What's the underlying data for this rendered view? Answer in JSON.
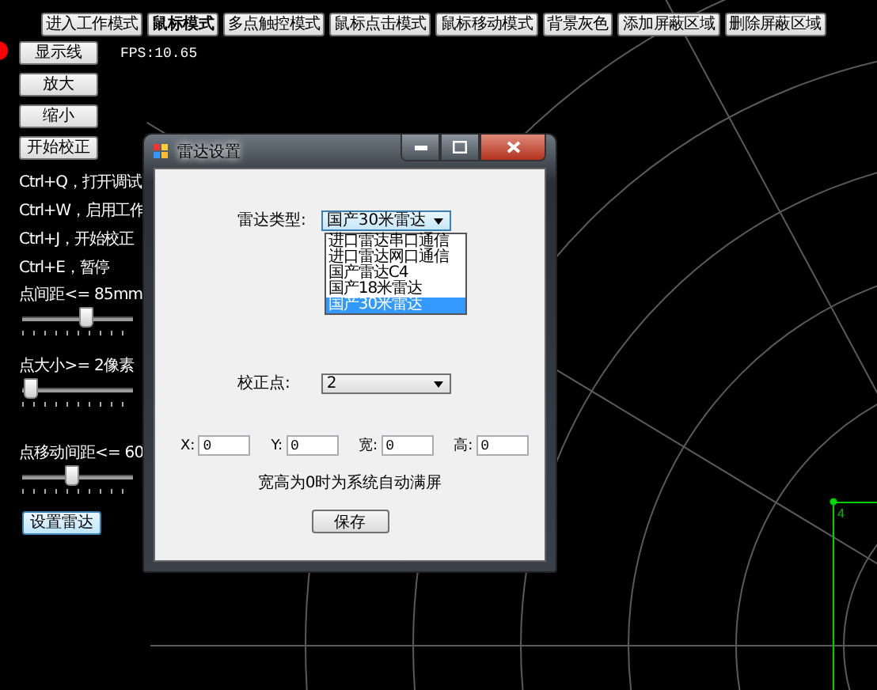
{
  "toolbar": [
    {
      "label": "进入工作模式",
      "selected": false
    },
    {
      "label": "鼠标模式",
      "selected": true
    },
    {
      "label": "多点触控模式",
      "selected": false
    },
    {
      "label": "鼠标点击模式",
      "selected": false
    },
    {
      "label": "鼠标移动模式",
      "selected": false
    },
    {
      "label": "背景灰色",
      "selected": false
    },
    {
      "label": "添加屏蔽区域",
      "selected": false
    },
    {
      "label": "删除屏蔽区域",
      "selected": false
    }
  ],
  "left_panel": {
    "buttons": [
      "显示线",
      "放大",
      "缩小",
      "开始校正"
    ],
    "fps": "FPS:10.65",
    "shortcuts": [
      "Ctrl+Q，打开调试",
      "Ctrl+W，启用工作",
      "Ctrl+J，开始校正",
      "Ctrl+E，暂停"
    ],
    "sliders": [
      {
        "label": "点间距<= 85mm",
        "level": 0.6
      },
      {
        "label": "点大小>= 2像素",
        "level": 0.05
      },
      {
        "label": "点移动间距<= 60",
        "level": 0.45
      }
    ],
    "radar_settings_button": "设置雷达"
  },
  "radar_view": {
    "marker_label": "4"
  },
  "dialog": {
    "title": "雷达设置",
    "radar_type_label": "雷达类型:",
    "radar_type_value": "国产30米雷达",
    "radar_type_options": [
      {
        "label": "进口雷达串口通信",
        "selected": false
      },
      {
        "label": "进口雷达网口通信",
        "selected": false
      },
      {
        "label": "国产雷达C4",
        "selected": false
      },
      {
        "label": "国产18米雷达",
        "selected": false
      },
      {
        "label": "国产30米雷达",
        "selected": true
      }
    ],
    "calibration_label": "校正点:",
    "calibration_value": "2",
    "fields": [
      {
        "label": "X:",
        "value": "0"
      },
      {
        "label": "Y:",
        "value": "0"
      },
      {
        "label": "宽:",
        "value": "0"
      },
      {
        "label": "高:",
        "value": "0"
      }
    ],
    "note": "宽高为0时为系统自动满屏",
    "save_button": "保存"
  }
}
